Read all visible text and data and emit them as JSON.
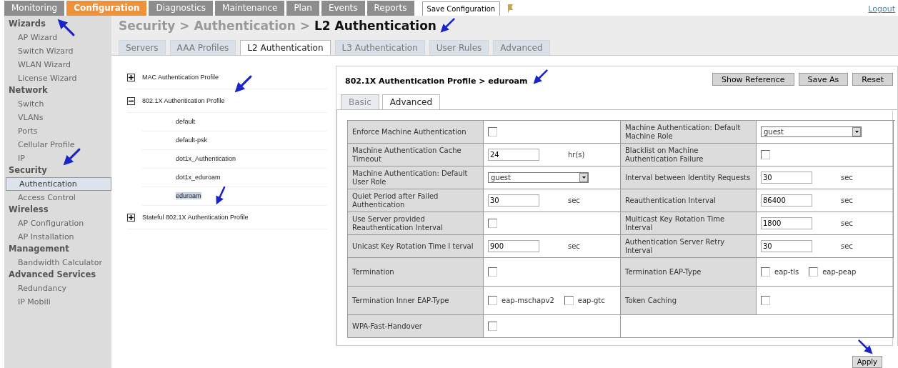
{
  "nav": {
    "tabs": [
      {
        "label": "Monitoring",
        "selected": false
      },
      {
        "label": "Configuration",
        "selected": true
      },
      {
        "label": "Diagnostics",
        "selected": false
      },
      {
        "label": "Maintenance",
        "selected": false
      },
      {
        "label": "Plan",
        "selected": false
      },
      {
        "label": "Events",
        "selected": false
      },
      {
        "label": "Reports",
        "selected": false
      }
    ],
    "save_button": "Save Configuration",
    "logout": "Logout"
  },
  "sidebar": {
    "sections": [
      {
        "title": "Wizards",
        "items": [
          {
            "label": "AP Wizard",
            "selected": false
          },
          {
            "label": "Switch Wizard",
            "selected": false
          },
          {
            "label": "WLAN Wizard",
            "selected": false
          },
          {
            "label": "License Wizard",
            "selected": false
          }
        ]
      },
      {
        "title": "Network",
        "items": [
          {
            "label": "Switch",
            "selected": false
          },
          {
            "label": "VLANs",
            "selected": false
          },
          {
            "label": "Ports",
            "selected": false
          },
          {
            "label": "Cellular Profile",
            "selected": false
          },
          {
            "label": "IP",
            "selected": false
          }
        ]
      },
      {
        "title": "Security",
        "items": [
          {
            "label": "Authentication",
            "selected": true
          },
          {
            "label": "Access Control",
            "selected": false
          }
        ]
      },
      {
        "title": "Wireless",
        "items": [
          {
            "label": "AP Configuration",
            "selected": false
          },
          {
            "label": "AP Installation",
            "selected": false
          }
        ]
      },
      {
        "title": "Management",
        "items": [
          {
            "label": "Bandwidth Calculator",
            "selected": false
          }
        ]
      },
      {
        "title": "Advanced Services",
        "items": [
          {
            "label": "Redundancy",
            "selected": false
          },
          {
            "label": "IP Mobili",
            "selected": false
          }
        ]
      }
    ]
  },
  "breadcrumb": {
    "path": "Security > Authentication >",
    "current": "L2 Authentication"
  },
  "tabs": [
    {
      "label": "Servers",
      "selected": false
    },
    {
      "label": "AAA Profiles",
      "selected": false
    },
    {
      "label": "L2 Authentication",
      "selected": true
    },
    {
      "label": "L3 Authentication",
      "selected": false
    },
    {
      "label": "User Rules",
      "selected": false
    },
    {
      "label": "Advanced",
      "selected": false
    }
  ],
  "tree": [
    {
      "label": "MAC Authentication Profile",
      "expanded": false
    },
    {
      "label": "802.1X Authentication Profile",
      "expanded": true,
      "children": [
        {
          "label": "default",
          "selected": false
        },
        {
          "label": "default-psk",
          "selected": false
        },
        {
          "label": "dot1x_Authentication",
          "selected": false
        },
        {
          "label": "dot1x_eduroam",
          "selected": false
        },
        {
          "label": "eduroam",
          "selected": true
        }
      ]
    },
    {
      "label": "Stateful 802.1X Authentication Profile",
      "expanded": false
    }
  ],
  "panel": {
    "title": "802.1X Authentication Profile > eduroam",
    "buttons": [
      "Show Reference",
      "Save As",
      "Reset"
    ],
    "subtabs": [
      {
        "label": "Basic",
        "selected": false
      },
      {
        "label": "Advanced",
        "selected": true
      }
    ],
    "rows": [
      {
        "left": {
          "label": "Enforce Machine Authentication",
          "kind": "checkbox",
          "checked": false
        },
        "right": {
          "label": "Machine Authentication: Default Machine Role",
          "kind": "select",
          "value": "guest"
        }
      },
      {
        "left": {
          "label": "Machine Authentication Cache Timeout",
          "kind": "input",
          "value": "24",
          "unit": "hr(s)"
        },
        "right": {
          "label": "Blacklist on Machine Authentication Failure",
          "kind": "checkbox",
          "checked": false
        }
      },
      {
        "left": {
          "label": "Machine Authentication: Default User Role",
          "kind": "select",
          "value": "guest"
        },
        "right": {
          "label": "Interval between Identity Requests",
          "kind": "input",
          "value": "30",
          "unit": "sec"
        }
      },
      {
        "left": {
          "label": "Quiet Period after Failed Authentication",
          "kind": "input",
          "value": "30",
          "unit": "sec"
        },
        "right": {
          "label": "Reauthentication Interval",
          "kind": "input",
          "value": "86400",
          "unit": "sec"
        }
      },
      {
        "left": {
          "label": "Use Server provided Reauthentication Interval",
          "kind": "checkbox",
          "checked": false
        },
        "right": {
          "label": "Multicast Key Rotation Time Interval",
          "kind": "input",
          "value": "1800",
          "unit": "sec"
        }
      },
      {
        "left": {
          "label": "Unicast Key Rotation Time I terval",
          "kind": "input",
          "value": "900",
          "unit": "sec"
        },
        "right": {
          "label": "Authentication Server Retry Interval",
          "kind": "input",
          "value": "30",
          "unit": "sec"
        }
      },
      {
        "left": {
          "label": "Termination",
          "kind": "checkbox",
          "checked": false
        },
        "right": {
          "label": "Termination EAP-Type",
          "kind": "options",
          "options": [
            {
              "label": "eap-tls",
              "checked": false
            },
            {
              "label": "eap-peap",
              "checked": false
            }
          ]
        }
      },
      {
        "left": {
          "label": "Termination Inner EAP-Type",
          "kind": "options",
          "options": [
            {
              "label": "eap-mschapv2",
              "checked": false
            },
            {
              "label": "eap-gtc",
              "checked": false
            }
          ]
        },
        "right": {
          "label": "Token Caching",
          "kind": "checkbox",
          "checked": false
        }
      },
      {
        "left": {
          "label": "WPA-Fast-Handover",
          "kind": "checkbox",
          "checked": false
        }
      }
    ]
  },
  "apply_button": "Apply"
}
